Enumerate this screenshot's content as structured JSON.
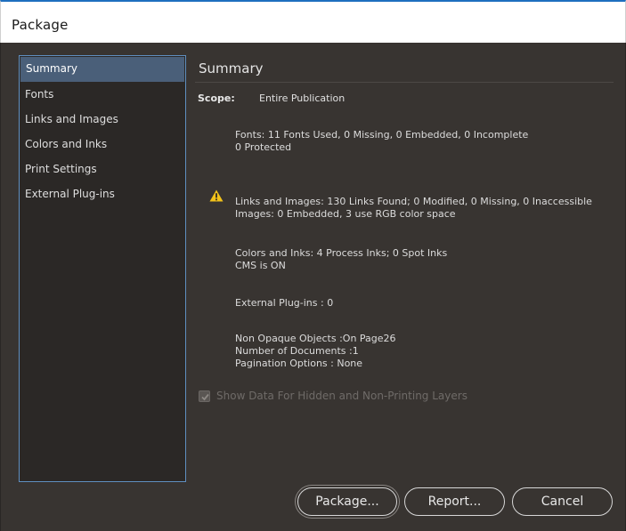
{
  "window": {
    "title": "Package"
  },
  "sidebar": {
    "items": [
      {
        "label": "Summary",
        "active": true
      },
      {
        "label": "Fonts"
      },
      {
        "label": "Links and Images"
      },
      {
        "label": "Colors and Inks"
      },
      {
        "label": "Print Settings"
      },
      {
        "label": "External Plug-ins"
      }
    ]
  },
  "summary": {
    "heading": "Summary",
    "scope_label": "Scope:",
    "scope_value": "Entire Publication",
    "fonts_line1": "Fonts: 11 Fonts Used, 0 Missing, 0 Embedded, 0 Incomplete",
    "fonts_line2": "0 Protected",
    "links_line1": "Links and Images: 130 Links Found; 0 Modified, 0 Missing, 0 Inaccessible",
    "links_line2": "Images: 0 Embedded, 3 use RGB color space",
    "links_warning_icon": "warning-icon",
    "colors_line1": "Colors and Inks: 4 Process Inks; 0 Spot Inks",
    "colors_line2": "CMS is ON",
    "plugins_line": "External Plug-ins : 0",
    "misc_line1": "Non Opaque Objects :On Page26",
    "misc_line2": "Number of Documents :1",
    "misc_line3": "Pagination Options : None"
  },
  "options": {
    "show_hidden_label": "Show Data For Hidden and Non-Printing Layers",
    "show_hidden_checked": true,
    "show_hidden_enabled": false
  },
  "buttons": {
    "package": "Package...",
    "report": "Report...",
    "cancel": "Cancel"
  },
  "colors": {
    "panel_bg": "#383431",
    "sidebar_bg": "#2b2826",
    "selection": "#4a5f79",
    "warning": "#f2c21a"
  }
}
